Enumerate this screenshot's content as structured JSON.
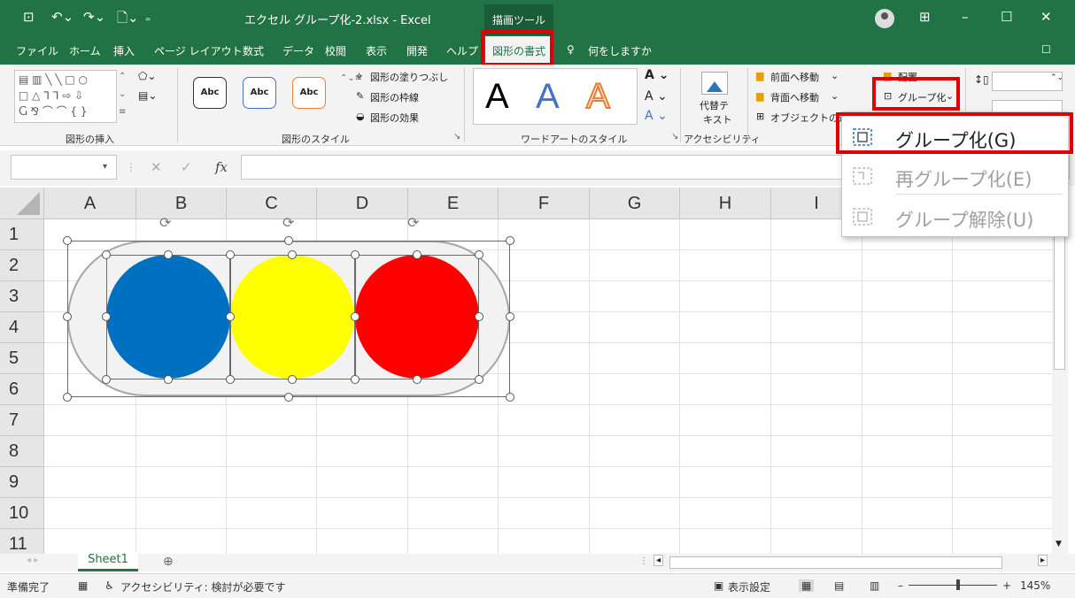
{
  "titlebar": {
    "file_title": "エクセル グループ化-2.xlsx  -  Excel",
    "context_tab": "描画ツール",
    "brand_color": "#217346"
  },
  "tabs": [
    {
      "label": "ファイル"
    },
    {
      "label": "ホーム"
    },
    {
      "label": "挿入"
    },
    {
      "label": "ページ レイアウト"
    },
    {
      "label": "数式"
    },
    {
      "label": "データ"
    },
    {
      "label": "校閲"
    },
    {
      "label": "表示"
    },
    {
      "label": "開発"
    },
    {
      "label": "ヘルプ"
    },
    {
      "label": "図形の書式",
      "active": true
    },
    {
      "label": "何をしますか"
    }
  ],
  "ribbon": {
    "insert_shapes_label": "図形の挿入",
    "shape_styles_label": "図形のスタイル",
    "style_samples": [
      "Abc",
      "Abc",
      "Abc"
    ],
    "fill_label": "図形の塗りつぶし",
    "outline_label": "図形の枠線",
    "effects_label": "図形の効果",
    "wordart_label": "ワードアートのスタイル",
    "wordart_samples": [
      "A",
      "A",
      "A"
    ],
    "alt_text_label_1": "代替テ",
    "alt_text_label_2": "キスト",
    "accessibility_label": "アクセシビリティ",
    "bring_forward": "前面へ移動",
    "send_backward": "背面へ移動",
    "selection_pane": "オブジェクトの選択",
    "align": "配置",
    "group": "グループ化"
  },
  "formula_bar": {
    "name_box": "",
    "formula": "",
    "fx": "fx"
  },
  "columns": [
    "A",
    "B",
    "C",
    "D",
    "E",
    "F",
    "G",
    "H",
    "I"
  ],
  "rows": [
    "1",
    "2",
    "3",
    "4",
    "5",
    "6",
    "7",
    "8",
    "9",
    "10",
    "11"
  ],
  "shapes": {
    "circle_colors": [
      "#0070c0",
      "#ffff00",
      "#ff0000"
    ],
    "pill_color": "#f2f2f2"
  },
  "menu": {
    "items": [
      {
        "label": "グループ化(G)",
        "enabled": true
      },
      {
        "label": "再グループ化(E)",
        "enabled": false
      },
      {
        "label": "グループ解除(U)",
        "enabled": false
      }
    ]
  },
  "sheet": {
    "tab": "Sheet1",
    "add_icon": "plus-circle-icon"
  },
  "status": {
    "ready": "準備完了",
    "accessibility": "アクセシビリティ: 検討が必要です",
    "display_settings": "表示設定",
    "zoom": "145%"
  }
}
